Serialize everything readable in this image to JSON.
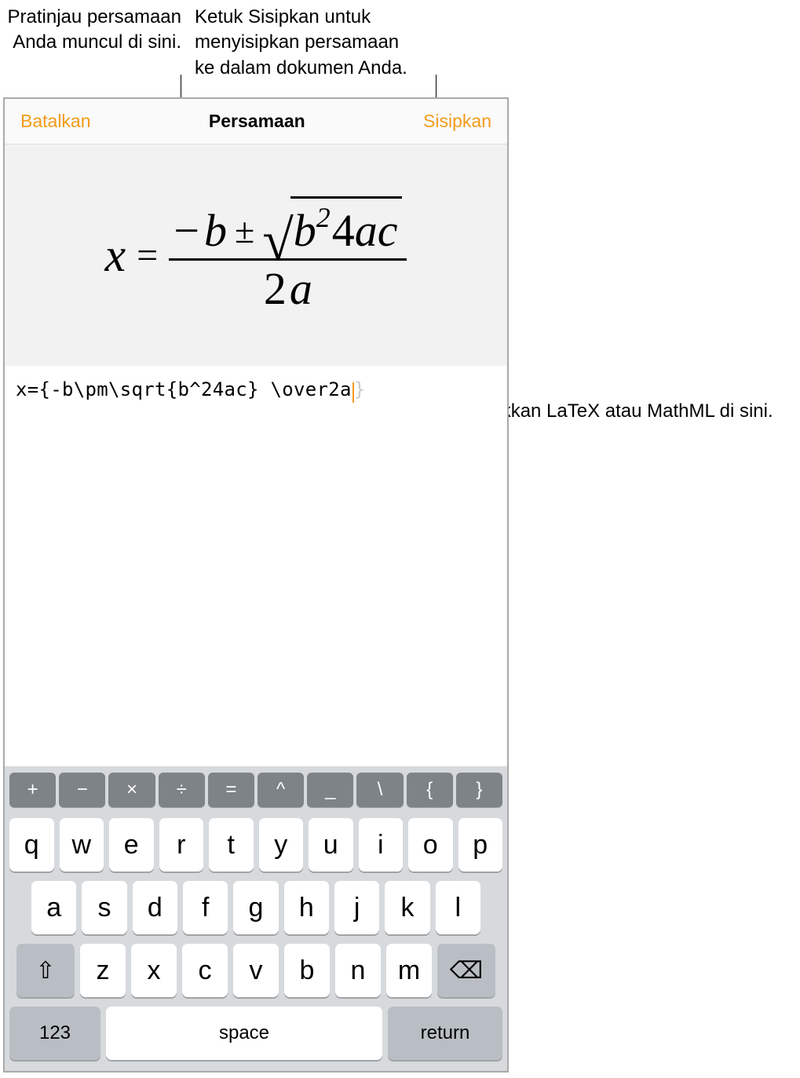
{
  "callouts": {
    "preview": "Pratinjau persamaan Anda muncul di sini.",
    "insert": "Ketuk Sisipkan untuk menyisipkan persamaan ke dalam dokumen Anda.",
    "input": "Masukkan LaTeX atau MathML di sini."
  },
  "navbar": {
    "cancel": "Batalkan",
    "title": "Persamaan",
    "insert": "Sisipkan"
  },
  "equation_preview": {
    "lhs": "x",
    "numerator_minus": "−",
    "numerator_b": "b",
    "pm": "±",
    "radicand_b": "b",
    "radicand_exp": "2",
    "radicand_4ac_4": "4",
    "radicand_4ac_a": "a",
    "radicand_4ac_c": "c",
    "denom_2": "2",
    "denom_a": "a"
  },
  "input": {
    "text": "x={-b\\pm\\sqrt{b^24ac} \\over2a",
    "ghost": "}"
  },
  "keyboard": {
    "symrow": [
      "+",
      "−",
      "×",
      "÷",
      "=",
      "^",
      "_",
      "\\",
      "{",
      "}"
    ],
    "row1": [
      "q",
      "w",
      "e",
      "r",
      "t",
      "y",
      "u",
      "i",
      "o",
      "p"
    ],
    "row2": [
      "a",
      "s",
      "d",
      "f",
      "g",
      "h",
      "j",
      "k",
      "l"
    ],
    "row3": [
      "z",
      "x",
      "c",
      "v",
      "b",
      "n",
      "m"
    ],
    "shift": "⇧",
    "backspace": "⌫",
    "num": "123",
    "space": "space",
    "return": "return"
  }
}
